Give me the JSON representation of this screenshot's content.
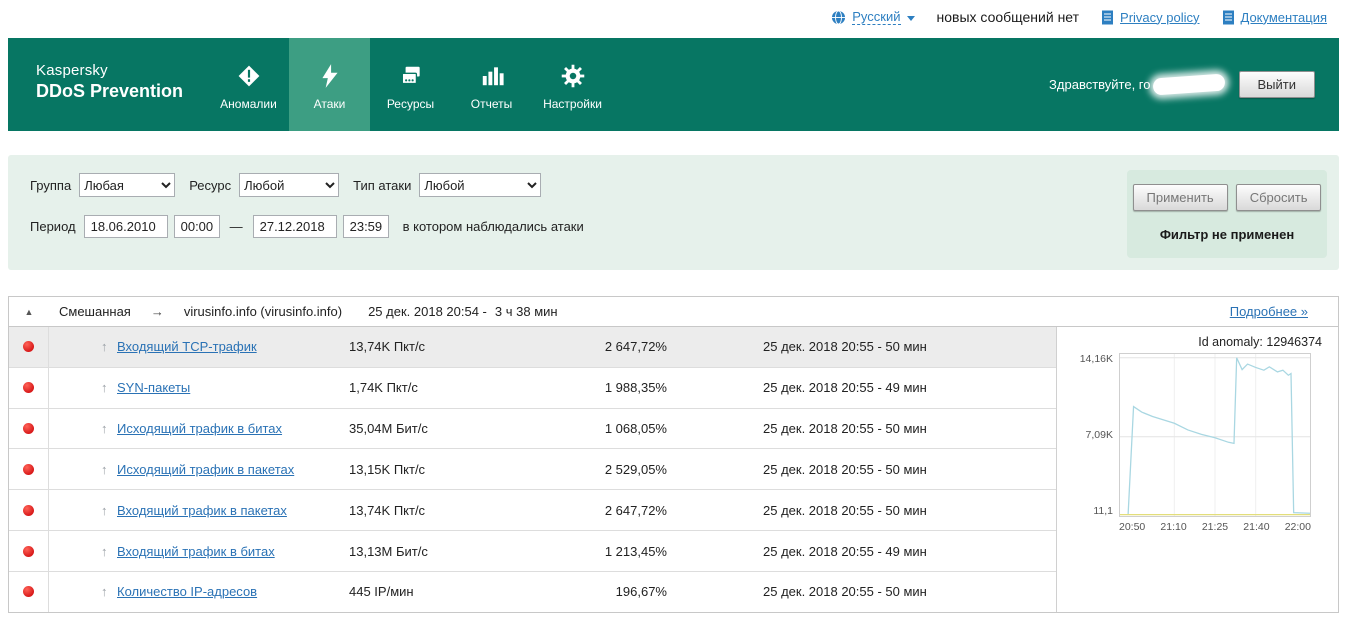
{
  "topbar": {
    "language": {
      "label": "Русский"
    },
    "messages": "новых сообщений нет",
    "privacy_policy": "Privacy policy",
    "documentation": "Документация"
  },
  "header": {
    "logo": {
      "line1": "Kaspersky",
      "line2": "DDoS Prevention"
    },
    "nav": [
      {
        "label": "Аномалии"
      },
      {
        "label": "Атаки"
      },
      {
        "label": "Ресурсы"
      },
      {
        "label": "Отчеты"
      },
      {
        "label": "Настройки"
      }
    ],
    "greeting": "Здравствуйте, го",
    "logout_label": "Выйти"
  },
  "filters": {
    "group": {
      "label": "Группа",
      "value": "Любая"
    },
    "resource": {
      "label": "Ресурс",
      "value": "Любой"
    },
    "attack_type": {
      "label": "Тип атаки",
      "value": "Любой"
    },
    "period": {
      "label": "Период",
      "date_from": "18.06.2010",
      "time_from": "00:00",
      "separator": "—",
      "date_to": "27.12.2018",
      "time_to": "23:59",
      "note": "в котором наблюдались атаки"
    },
    "apply_label": "Применить",
    "reset_label": "Сбросить",
    "status": "Фильтр не применен"
  },
  "attack_group": {
    "collapse_icon": "▲",
    "type": "Смешанная",
    "arrow": "→",
    "resource": "virusinfo.info (virusinfo.info)",
    "datetime": "25 дек. 2018 20:54 -",
    "duration": "3 ч 38 мин",
    "details_link": "Подробнее »"
  },
  "attacks": {
    "trend_icon": "↑",
    "rows": [
      {
        "name": "Входящий TCP-трафик",
        "value": "13,74K Пкт/с",
        "percent": "2 647,72%",
        "time": "25 дек. 2018 20:55 - 50 мин",
        "selected": true
      },
      {
        "name": "SYN-пакеты",
        "value": "1,74K Пкт/с",
        "percent": "1 988,35%",
        "time": "25 дек. 2018 20:55 - 49 мин",
        "selected": false
      },
      {
        "name": "Исходящий трафик в битах",
        "value": "35,04M Бит/с",
        "percent": "1 068,05%",
        "time": "25 дек. 2018 20:55 - 50 мин",
        "selected": false
      },
      {
        "name": "Исходящий трафик в пакетах",
        "value": "13,15K Пкт/с",
        "percent": "2 529,05%",
        "time": "25 дек. 2018 20:55 - 50 мин",
        "selected": false
      },
      {
        "name": "Входящий трафик в пакетах",
        "value": "13,74K Пкт/с",
        "percent": "2 647,72%",
        "time": "25 дек. 2018 20:55 - 50 мин",
        "selected": false
      },
      {
        "name": "Входящий трафик в битах",
        "value": "13,13M Бит/с",
        "percent": "1 213,45%",
        "time": "25 дек. 2018 20:55 - 49 мин",
        "selected": false
      },
      {
        "name": "Количество IP-адресов",
        "value": "445 IP/мин",
        "percent": "196,67%",
        "time": "25 дек. 2018 20:55 - 50 мин",
        "selected": false
      }
    ]
  },
  "chart_data": {
    "type": "line",
    "title": "Id anomaly: 12946374",
    "x_ticks": [
      "20:50",
      "21:10",
      "21:25",
      "21:40",
      "22:00"
    ],
    "x_range_minutes": [
      0,
      70
    ],
    "y_range": [
      0,
      14500
    ],
    "y_tick_labels": {
      "top": "14,16K",
      "middle": "7,09K",
      "bottom": "11,1"
    },
    "y_gridlines": [
      14160,
      7090
    ],
    "x_gridlines_minutes": [
      20,
      35,
      50
    ],
    "grid": true,
    "legend": false,
    "series": [
      {
        "name": "incoming-tcp-traffic",
        "color": "#a9d7e2",
        "x": [
          3,
          5,
          8,
          12,
          16,
          20,
          25,
          30,
          35,
          40,
          42,
          43,
          45,
          47,
          50,
          53,
          55,
          58,
          60,
          62,
          63,
          64,
          70
        ],
        "y": [
          150,
          9800,
          9300,
          8900,
          8600,
          8300,
          7700,
          7300,
          7000,
          6600,
          6500,
          14160,
          13100,
          13600,
          13300,
          13050,
          13350,
          12900,
          13050,
          12600,
          12750,
          300,
          250
        ]
      },
      {
        "name": "baseline-threshold",
        "color": "#e3de7a",
        "x": [
          0,
          70
        ],
        "y": [
          120,
          120
        ]
      }
    ]
  }
}
